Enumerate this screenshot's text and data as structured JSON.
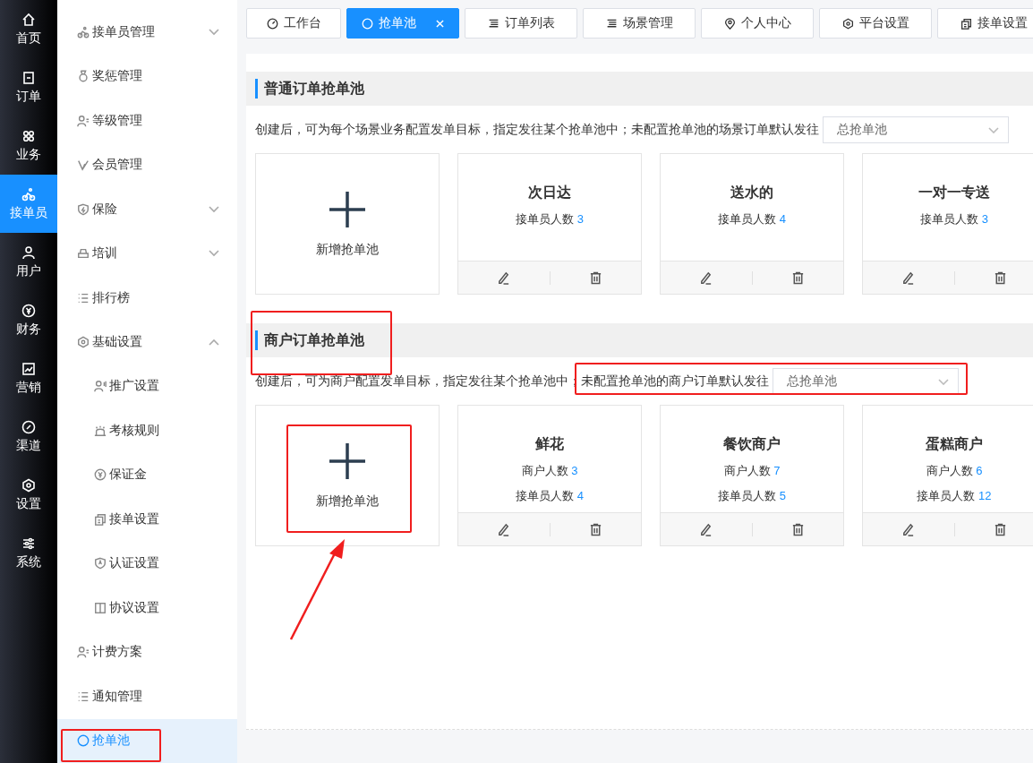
{
  "rail": [
    {
      "label": "首页",
      "selected": false
    },
    {
      "label": "订单",
      "selected": false
    },
    {
      "label": "业务",
      "selected": false
    },
    {
      "label": "接单员",
      "selected": true
    },
    {
      "label": "用户",
      "selected": false
    },
    {
      "label": "财务",
      "selected": false
    },
    {
      "label": "营销",
      "selected": false
    },
    {
      "label": "渠道",
      "selected": false
    },
    {
      "label": "设置",
      "selected": false
    },
    {
      "label": "系统",
      "selected": false
    }
  ],
  "menu": [
    {
      "label": "接单员管理",
      "expanded": false,
      "selected": false
    },
    {
      "label": "奖惩管理",
      "selected": false
    },
    {
      "label": "等级管理",
      "selected": false
    },
    {
      "label": "会员管理",
      "selected": false
    },
    {
      "label": "保险",
      "expanded": false,
      "selected": false
    },
    {
      "label": "培训",
      "expanded": false,
      "selected": false
    },
    {
      "label": "排行榜",
      "selected": false
    },
    {
      "label": "基础设置",
      "expanded": true,
      "selected": false,
      "children": [
        {
          "label": "推广设置",
          "selected": false
        },
        {
          "label": "考核规则",
          "selected": false
        },
        {
          "label": "保证金",
          "selected": false
        },
        {
          "label": "接单设置",
          "selected": false
        },
        {
          "label": "认证设置",
          "selected": false
        },
        {
          "label": "协议设置",
          "selected": false
        }
      ]
    },
    {
      "label": "计费方案",
      "selected": false
    },
    {
      "label": "通知管理",
      "selected": false
    },
    {
      "label": "抢单池",
      "selected": true
    }
  ],
  "tabs": [
    {
      "label": "工作台",
      "selected": false,
      "closable": false
    },
    {
      "label": "抢单池",
      "selected": true,
      "closable": true
    },
    {
      "label": "订单列表",
      "selected": false,
      "closable": false
    },
    {
      "label": "场景管理",
      "selected": false,
      "closable": false
    },
    {
      "label": "个人中心",
      "selected": false,
      "closable": false
    },
    {
      "label": "平台设置",
      "selected": false,
      "closable": false
    },
    {
      "label": "接单设置",
      "selected": false,
      "closable": false
    }
  ],
  "sections": [
    {
      "title": "普通订单抢单池",
      "description": "创建后，可为每个场景业务配置发单目标，指定发往某个抢单池中；",
      "default_label": "未配置抢单池的场景订单默认发往",
      "default_select": "总抢单池",
      "add_label": "新增抢单池",
      "pools": [
        {
          "name": "次日达",
          "stats": [
            {
              "label": "接单员人数",
              "value": "3"
            }
          ]
        },
        {
          "name": "送水的",
          "stats": [
            {
              "label": "接单员人数",
              "value": "4"
            }
          ]
        },
        {
          "name": "一对一专送",
          "stats": [
            {
              "label": "接单员人数",
              "value": "3"
            }
          ]
        }
      ]
    },
    {
      "title": "商户订单抢单池",
      "description": "创建后，可为商户配置发单目标，指定发往某个抢单池中；",
      "default_label": "未配置抢单池的商户订单默认发往",
      "default_select": "总抢单池",
      "add_label": "新增抢单池",
      "pools": [
        {
          "name": "鲜花",
          "stats": [
            {
              "label": "商户人数",
              "value": "3"
            },
            {
              "label": "接单员人数",
              "value": "4"
            }
          ]
        },
        {
          "name": "餐饮商户",
          "stats": [
            {
              "label": "商户人数",
              "value": "7"
            },
            {
              "label": "接单员人数",
              "value": "5"
            }
          ]
        },
        {
          "name": "蛋糕商户",
          "stats": [
            {
              "label": "商户人数",
              "value": "6"
            },
            {
              "label": "接单员人数",
              "value": "12"
            }
          ]
        }
      ]
    }
  ]
}
